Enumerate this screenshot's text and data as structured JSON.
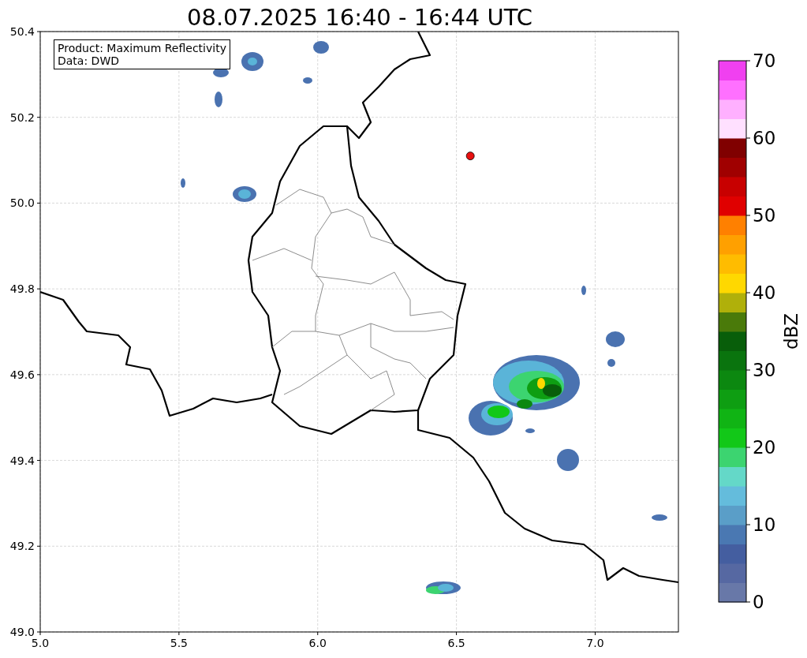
{
  "title": "08.07.2025 16:40 - 16:44 UTC",
  "info_box": [
    "Product: Maximum Reflectivity",
    "Data: DWD"
  ],
  "chart_data": {
    "type": "scatter",
    "grid": true,
    "xlim": [
      5,
      7.3
    ],
    "ylim": [
      49,
      50.4
    ],
    "xticks": [
      {
        "value": 5,
        "label": "5.0"
      },
      {
        "value": 5.5,
        "label": "5.5"
      },
      {
        "value": 6,
        "label": "6.0"
      },
      {
        "value": 6.5,
        "label": "6.5"
      },
      {
        "value": 7,
        "label": "7.0"
      }
    ],
    "yticks": [
      {
        "value": 49,
        "label": "49.0"
      },
      {
        "value": 49.2,
        "label": "49.2"
      },
      {
        "value": 49.4,
        "label": "49.4"
      },
      {
        "value": 49.6,
        "label": "49.6"
      },
      {
        "value": 49.8,
        "label": "49.8"
      },
      {
        "value": 50,
        "label": "50.0"
      },
      {
        "value": 50.2,
        "label": "50.2"
      },
      {
        "value": 50.4,
        "label": "50.4"
      }
    ],
    "x": [
      6.55
    ],
    "series": [
      {
        "color": "#e81010",
        "values": [
          50.11
        ]
      }
    ]
  },
  "colorbar": {
    "label": "dBZ",
    "ticks": [
      "70",
      "60",
      "50",
      "40",
      "30",
      "20",
      "10",
      "0"
    ],
    "segments": [
      {
        "color": "#6878a8"
      },
      {
        "color": "#5668a2"
      },
      {
        "color": "#445ea0"
      },
      {
        "color": "#4a78b2"
      },
      {
        "color": "#5a9ec8"
      },
      {
        "color": "#64bcdc"
      },
      {
        "color": "#64d8c8"
      },
      {
        "color": "#3cd470"
      },
      {
        "color": "#12c818"
      },
      {
        "color": "#10b414"
      },
      {
        "color": "#0e9e12"
      },
      {
        "color": "#0c8810"
      },
      {
        "color": "#0a740e"
      },
      {
        "color": "#085e0a"
      },
      {
        "color": "#4a7a0a"
      },
      {
        "color": "#b0b00a"
      },
      {
        "color": "#ffd800"
      },
      {
        "color": "#ffbc00"
      },
      {
        "color": "#ffa000"
      },
      {
        "color": "#ff8000"
      },
      {
        "color": "#e00000"
      },
      {
        "color": "#c80000"
      },
      {
        "color": "#a00000"
      },
      {
        "color": "#800000"
      },
      {
        "color": "#ffe0ff"
      },
      {
        "color": "#ffb0ff"
      },
      {
        "color": "#ff70ff"
      },
      {
        "color": "#f040f0"
      }
    ]
  }
}
